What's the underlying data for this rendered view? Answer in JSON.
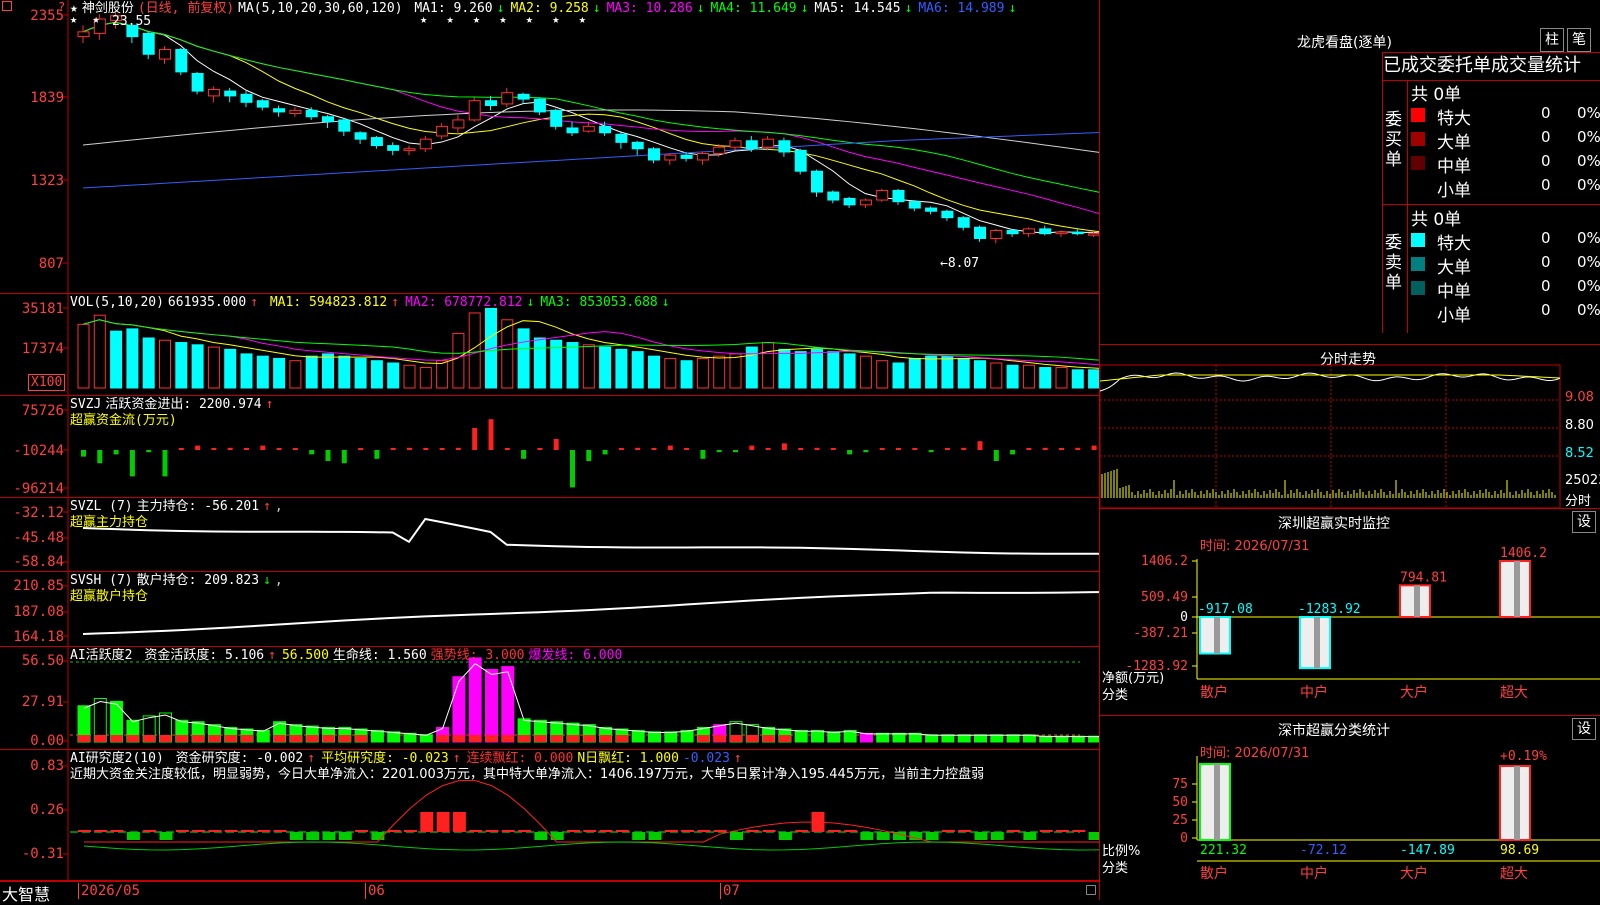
{
  "window": {
    "app": "大智慧"
  },
  "kline": {
    "star": "★",
    "name": "神剑股份",
    "mode": "(日线, 前复权)",
    "ma_params": "MA(5,10,20,30,60,120)",
    "ma_values": [
      {
        "label": "MA1: 9.260",
        "arrow": "↓",
        "color": "#ffffff"
      },
      {
        "label": "MA2: 9.258",
        "arrow": "↓",
        "color": "#ffff00"
      },
      {
        "label": "MA3: 10.286",
        "arrow": "↓",
        "color": "#ff00ff"
      },
      {
        "label": "MA4: 11.649",
        "arrow": "↓",
        "color": "#00ff00"
      },
      {
        "label": "MA5: 14.545",
        "arrow": "↓",
        "color": "#ffffff"
      },
      {
        "label": "MA6: 14.989",
        "arrow": "↓",
        "color": "#3060ff"
      }
    ],
    "high_note": "23.55",
    "low_note": "←8.07",
    "y_ticks": [
      "2355",
      "1839",
      "1323",
      "807"
    ],
    "x_labels": [
      "2026/05",
      "06",
      "07"
    ]
  },
  "vol": {
    "title": "VOL(5,10,20)",
    "value": "661935.000",
    "ma": [
      {
        "label": "MA1: 594823.812",
        "arrow": "↑",
        "color": "#ffff00"
      },
      {
        "label": "MA2: 678772.812",
        "arrow": "↓",
        "color": "#ff00ff"
      },
      {
        "label": "MA3: 853053.688",
        "arrow": "↓",
        "color": "#00ff00"
      }
    ],
    "y_ticks": [
      "35181",
      "17374"
    ],
    "unit": "X100"
  },
  "svzj": {
    "title": "SVZJ",
    "label": "活跃资金进出: 2200.974",
    "sub": "超赢资金流(万元)",
    "y_ticks": [
      "75726",
      "-10244",
      "-96214"
    ]
  },
  "svzl": {
    "title": "SVZL (7)",
    "label": "主力持仓: -56.201",
    "sub": "超赢主力持仓",
    "y_ticks": [
      "-32.12",
      "-45.48",
      "-58.84"
    ]
  },
  "svsh": {
    "title": "SVSH (7)",
    "label": "散户持仓: 209.823",
    "sub": "超赢散户持仓",
    "y_ticks": [
      "210.85",
      "187.08",
      "164.18"
    ]
  },
  "ai_active": {
    "title": "AI活跃度2",
    "items": [
      {
        "label": "资金活跃度: 5.106",
        "arrow": "↑",
        "color": "#ffffff"
      },
      {
        "label": "56.500",
        "arrow": "",
        "color": "#ffff00"
      },
      {
        "label": "生命线: 1.560",
        "arrow": "",
        "color": "#ffffff"
      },
      {
        "label": "强势线: 3.000",
        "arrow": "",
        "color": "#ff3030"
      },
      {
        "label": "爆发线: 6.000",
        "arrow": "",
        "color": "#ff00ff"
      }
    ],
    "y_ticks": [
      "56.50",
      "27.91",
      "0.00"
    ]
  },
  "ai_research": {
    "title": "AI研究度2(10)",
    "items": [
      {
        "label": "资金研究度: -0.002",
        "arrow": "↑",
        "color": "#ffffff"
      },
      {
        "label": "平均研究度: -0.023",
        "arrow": "↑",
        "color": "#ffff00"
      },
      {
        "label": "连续飘红: 0.000",
        "arrow": "",
        "color": "#ff3030"
      },
      {
        "label": "N日飘红: 1.000",
        "arrow": "",
        "color": "#ffff00"
      },
      {
        "label": "-0.023",
        "arrow": "↑",
        "color": "#3060ff"
      }
    ],
    "comment": "近期大资金关注度较低，明显弱势，今日大单净流入：2201.003万元，其中特大单净流入：1406.197万元，大单5日累计净入195.445万元，当前主力控盘弱",
    "y_ticks": [
      "0.83",
      "0.26",
      "-0.31"
    ]
  },
  "dragon": {
    "title": "龙虎看盘(逐单)",
    "btn_zhu": "柱",
    "btn_bi": "笔",
    "tabs": [
      "已成交",
      "委托单",
      "成交量统计"
    ],
    "buy_side": "委买单",
    "sell_side": "委卖单",
    "buy_total": "共 0单",
    "sell_total": "共 0单",
    "buy_rows": [
      {
        "name": "特大",
        "n": "0",
        "p": "0%",
        "color": "#ff0000"
      },
      {
        "name": "大单",
        "n": "0",
        "p": "0%",
        "color": "#a00000"
      },
      {
        "name": "中单",
        "n": "0",
        "p": "0%",
        "color": "#600000"
      },
      {
        "name": "小单",
        "n": "0",
        "p": "0%",
        "color": ""
      }
    ],
    "sell_rows": [
      {
        "name": "特大",
        "n": "0",
        "p": "0%",
        "color": "#00ffff"
      },
      {
        "name": "大单",
        "n": "0",
        "p": "0%",
        "color": "#008080"
      },
      {
        "name": "中单",
        "n": "0",
        "p": "0%",
        "color": "#006060"
      },
      {
        "name": "小单",
        "n": "0",
        "p": "0%",
        "color": ""
      }
    ]
  },
  "intraday": {
    "title": "分时走势",
    "y_ticks": [
      "9.08",
      "8.80",
      "8.52"
    ],
    "vol_label": "25023",
    "vol_unit": "分时"
  },
  "sz_monitor": {
    "title": "深圳超赢实时监控",
    "btn": "设",
    "time": "时间: 2026/07/31",
    "y_ticks": [
      "1406.2",
      "509.49",
      "0",
      "-387.21",
      "-1283.92"
    ],
    "ylabel": "净额(万元)",
    "xlabel": "分类",
    "categories": [
      "散户",
      "中户",
      "大户",
      "超大"
    ],
    "value_labels": [
      "-917.08",
      "-1283.92",
      "794.81",
      "1406.2"
    ]
  },
  "sz_stats": {
    "title": "深市超赢分类统计",
    "btn": "设",
    "time": "时间: 2026/07/31",
    "y_ticks": [
      "75",
      "50",
      "25",
      "0"
    ],
    "ylabel": "比例%",
    "xlabel": "分类",
    "categories": [
      "散户",
      "中户",
      "大户",
      "超大"
    ],
    "value_labels": [
      "221.32",
      "-72.12",
      "-147.89",
      "98.69"
    ],
    "top_label": "+0.19%"
  },
  "chart_data": [
    {
      "type": "candlestick",
      "title": "神剑股份 (日线, 前复权)",
      "ylim": [
        807,
        2355
      ],
      "x_labels": [
        "2026/05",
        "06",
        "07"
      ],
      "candles": [
        [
          2220,
          2250,
          2180,
          2290
        ],
        [
          2240,
          2330,
          2200,
          2360
        ],
        [
          2320,
          2350,
          2270,
          2370
        ],
        [
          2290,
          2220,
          2180,
          2300
        ],
        [
          2240,
          2110,
          2080,
          2250
        ],
        [
          2080,
          2140,
          2050,
          2160
        ],
        [
          2140,
          2000,
          1980,
          2150
        ],
        [
          1990,
          1880,
          1860,
          2000
        ],
        [
          1850,
          1890,
          1810,
          1910
        ],
        [
          1880,
          1850,
          1810,
          1900
        ],
        [
          1860,
          1810,
          1780,
          1880
        ],
        [
          1820,
          1780,
          1760,
          1830
        ],
        [
          1770,
          1750,
          1720,
          1790
        ],
        [
          1740,
          1760,
          1720,
          1780
        ],
        [
          1760,
          1720,
          1700,
          1780
        ],
        [
          1720,
          1690,
          1650,
          1730
        ],
        [
          1700,
          1630,
          1600,
          1710
        ],
        [
          1620,
          1580,
          1550,
          1630
        ],
        [
          1590,
          1540,
          1520,
          1600
        ],
        [
          1540,
          1510,
          1480,
          1560
        ],
        [
          1510,
          1520,
          1480,
          1540
        ],
        [
          1520,
          1580,
          1500,
          1600
        ],
        [
          1600,
          1660,
          1580,
          1680
        ],
        [
          1650,
          1700,
          1620,
          1730
        ],
        [
          1700,
          1820,
          1690,
          1840
        ],
        [
          1820,
          1790,
          1760,
          1850
        ],
        [
          1800,
          1870,
          1780,
          1900
        ],
        [
          1860,
          1830,
          1800,
          1870
        ],
        [
          1830,
          1750,
          1730,
          1840
        ],
        [
          1760,
          1660,
          1640,
          1770
        ],
        [
          1650,
          1620,
          1600,
          1690
        ],
        [
          1630,
          1660,
          1620,
          1690
        ],
        [
          1660,
          1620,
          1600,
          1690
        ],
        [
          1610,
          1560,
          1520,
          1630
        ],
        [
          1560,
          1520,
          1480,
          1570
        ],
        [
          1520,
          1450,
          1430,
          1530
        ],
        [
          1450,
          1480,
          1420,
          1490
        ],
        [
          1480,
          1460,
          1440,
          1500
        ],
        [
          1450,
          1490,
          1420,
          1500
        ],
        [
          1490,
          1530,
          1470,
          1550
        ],
        [
          1530,
          1570,
          1510,
          1590
        ],
        [
          1570,
          1520,
          1500,
          1600
        ],
        [
          1530,
          1580,
          1510,
          1600
        ],
        [
          1570,
          1500,
          1470,
          1590
        ],
        [
          1510,
          1380,
          1360,
          1520
        ],
        [
          1380,
          1250,
          1220,
          1390
        ],
        [
          1250,
          1200,
          1180,
          1260
        ],
        [
          1210,
          1170,
          1150,
          1220
        ],
        [
          1170,
          1200,
          1150,
          1210
        ],
        [
          1200,
          1260,
          1190,
          1270
        ],
        [
          1260,
          1190,
          1170,
          1270
        ],
        [
          1190,
          1150,
          1130,
          1200
        ],
        [
          1150,
          1130,
          1110,
          1160
        ],
        [
          1130,
          1090,
          1070,
          1140
        ],
        [
          1090,
          1030,
          1010,
          1100
        ],
        [
          1030,
          960,
          940,
          1040
        ],
        [
          960,
          1010,
          930,
          1020
        ],
        [
          1010,
          990,
          970,
          1020
        ],
        [
          990,
          1020,
          970,
          1030
        ],
        [
          1020,
          990,
          980,
          1040
        ],
        [
          990,
          1000,
          970,
          1010
        ],
        [
          1000,
          990,
          980,
          1020
        ],
        [
          990,
          990,
          970,
          1000
        ],
        [
          990,
          960,
          940,
          1000
        ],
        [
          960,
          940,
          930,
          970
        ],
        [
          940,
          950,
          930,
          960
        ]
      ]
    },
    {
      "type": "bar",
      "title": "VOL(5,10,20)",
      "ylim": [
        0,
        35181
      ],
      "values": [
        28000,
        32000,
        25000,
        26000,
        22000,
        21000,
        20000,
        19000,
        18000,
        17000,
        15000,
        14000,
        13000,
        12000,
        14000,
        15000,
        14000,
        13000,
        12000,
        11000,
        10000,
        9000,
        12000,
        24000,
        33000,
        35000,
        30000,
        26000,
        22000,
        21000,
        20000,
        19000,
        18000,
        17000,
        16000,
        14000,
        13000,
        12000,
        13000,
        14000,
        15000,
        18000,
        20000,
        17000,
        16000,
        17000,
        16000,
        15000,
        14000,
        12000,
        11000,
        13000,
        14000,
        14000,
        13000,
        12000,
        11000,
        10000,
        10000,
        9000,
        9000,
        8000,
        8000,
        8000,
        9000,
        9000
      ],
      "up": [
        1,
        1,
        0,
        0,
        0,
        1,
        0,
        0,
        1,
        0,
        0,
        0,
        0,
        1,
        0,
        0,
        0,
        0,
        0,
        0,
        1,
        1,
        1,
        1,
        1,
        0,
        1,
        0,
        0,
        0,
        0,
        1,
        0,
        0,
        0,
        0,
        1,
        0,
        1,
        1,
        1,
        0,
        1,
        0,
        0,
        0,
        0,
        0,
        1,
        1,
        0,
        0,
        0,
        0,
        0,
        0,
        1,
        0,
        1,
        0,
        1,
        0,
        0,
        0,
        0,
        1
      ]
    }
  ]
}
